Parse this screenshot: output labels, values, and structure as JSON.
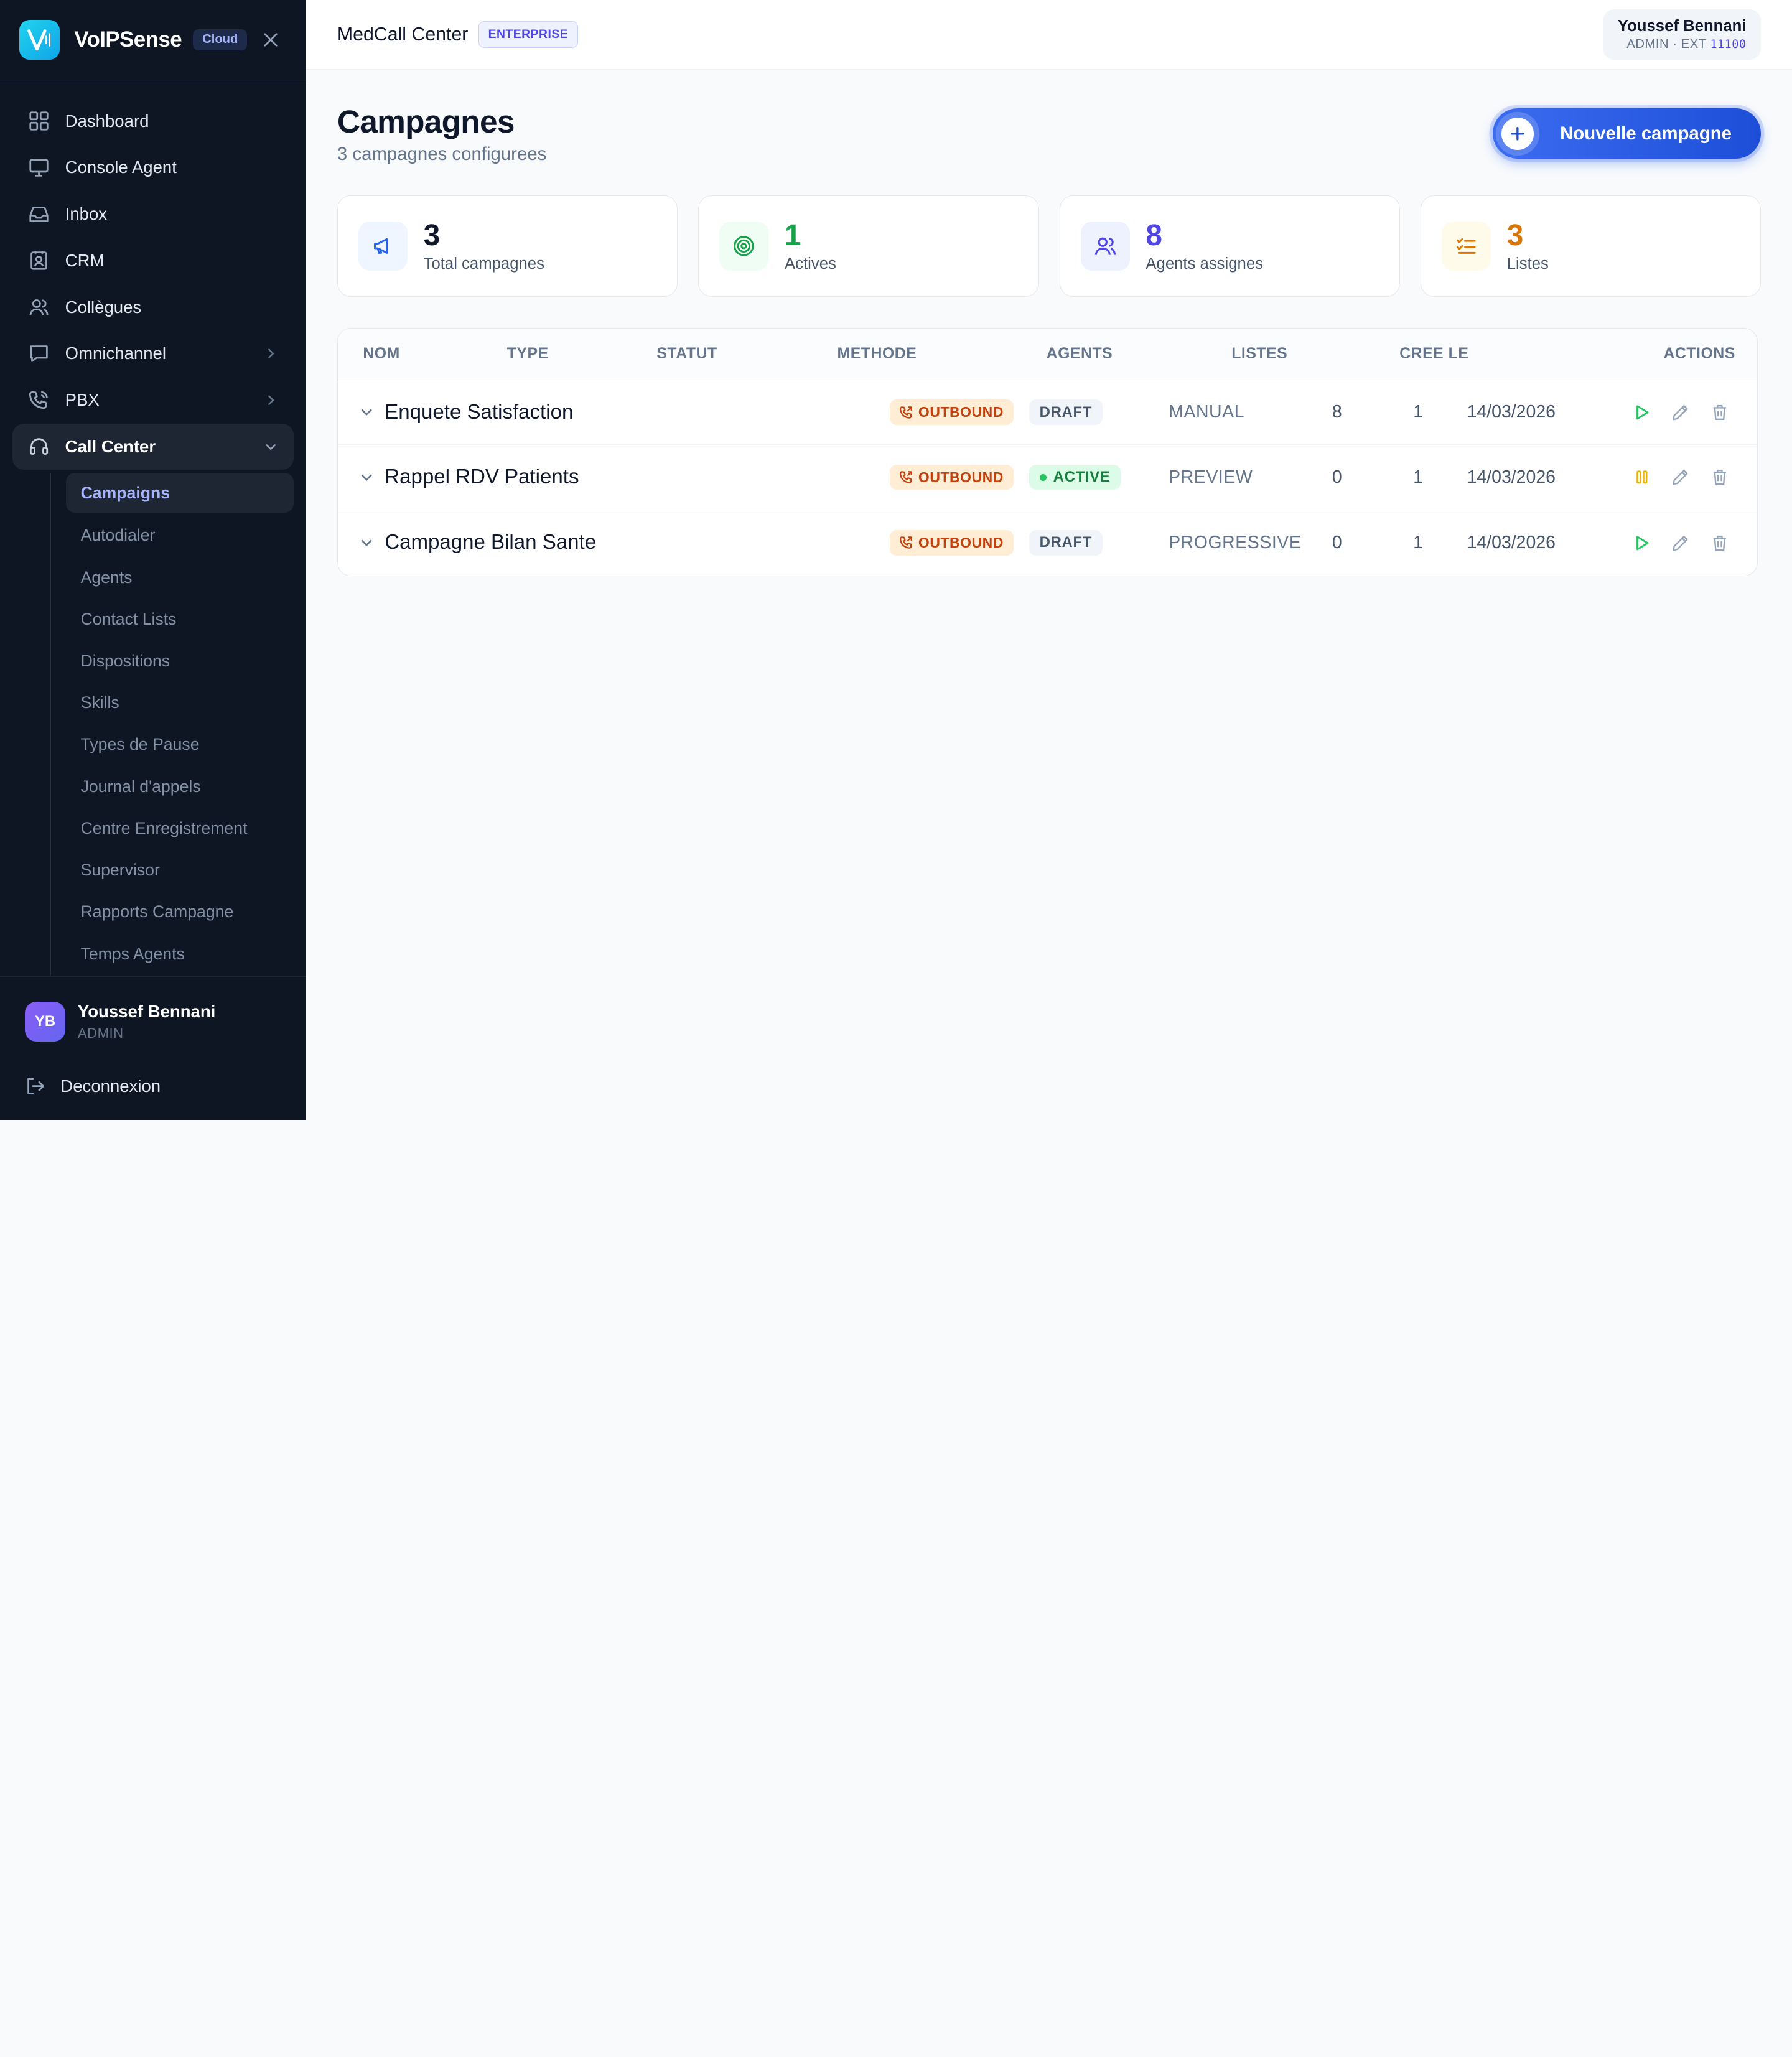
{
  "brand": {
    "name": "VoIPSense",
    "badge": "Cloud"
  },
  "sidebar": {
    "items": [
      {
        "label": "Dashboard",
        "icon": "dashboard-icon"
      },
      {
        "label": "Console Agent",
        "icon": "monitor-icon"
      },
      {
        "label": "Inbox",
        "icon": "inbox-icon"
      },
      {
        "label": "CRM",
        "icon": "contact-book-icon"
      },
      {
        "label": "Collègues",
        "icon": "users-icon"
      },
      {
        "label": "Omnichannel",
        "icon": "chat-icon"
      },
      {
        "label": "PBX",
        "icon": "phone-icon"
      },
      {
        "label": "Call Center",
        "icon": "headset-icon"
      }
    ],
    "sub_items": [
      "Campaigns",
      "Autodialer",
      "Agents",
      "Contact Lists",
      "Dispositions",
      "Skills",
      "Types de Pause",
      "Journal d'appels",
      "Centre Enregistrement",
      "Supervisor",
      "Rapports Campagne",
      "Temps Agents"
    ],
    "user": {
      "initials": "YB",
      "name": "Youssef Bennani",
      "role": "ADMIN"
    },
    "logout_label": "Deconnexion"
  },
  "topbar": {
    "org_name": "MedCall Center",
    "org_badge": "ENTERPRISE",
    "user_name": "Youssef Bennani",
    "user_sub": "ADMIN · EXT",
    "user_ext": "11100"
  },
  "page": {
    "title": "Campagnes",
    "subtitle": "3 campagnes configurees",
    "new_button": "Nouvelle campagne"
  },
  "stats": [
    {
      "value": "3",
      "label": "Total campagnes",
      "color": "#0f172a",
      "bg": "#eff6ff",
      "icon": "megaphone-icon"
    },
    {
      "value": "1",
      "label": "Actives",
      "color": "#16a34a",
      "bg": "#f0fdf4",
      "icon": "target-icon"
    },
    {
      "value": "8",
      "label": "Agents assignes",
      "color": "#4f46e5",
      "bg": "#eef2ff",
      "icon": "users-icon"
    },
    {
      "value": "3",
      "label": "Listes",
      "color": "#d97706",
      "bg": "#fffbeb",
      "icon": "checklist-icon"
    }
  ],
  "table": {
    "headers": [
      "NOM",
      "TYPE",
      "STATUT",
      "METHODE",
      "AGENTS",
      "LISTES",
      "CREE LE",
      "ACTIONS"
    ],
    "rows": [
      {
        "name": "Enquete Satisfaction",
        "type": "OUTBOUND",
        "status": "DRAFT",
        "method": "MANUAL",
        "agents": "8",
        "lists": "1",
        "created": "14/03/2026",
        "action": "play"
      },
      {
        "name": "Rappel RDV Patients",
        "type": "OUTBOUND",
        "status": "ACTIVE",
        "method": "PREVIEW",
        "agents": "0",
        "lists": "1",
        "created": "14/03/2026",
        "action": "pause"
      },
      {
        "name": "Campagne Bilan Sante",
        "type": "OUTBOUND",
        "status": "DRAFT",
        "method": "PROGRESSIVE",
        "agents": "0",
        "lists": "1",
        "created": "14/03/2026",
        "action": "play"
      }
    ]
  }
}
